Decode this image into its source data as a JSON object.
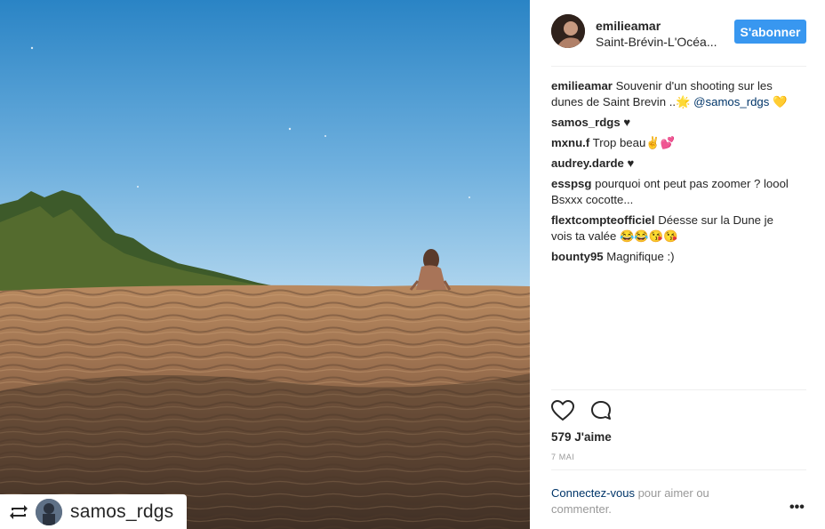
{
  "post": {
    "username": "emilieamar",
    "location": "Saint-Brévin-L'Océa...",
    "follow_label": "S'abonner",
    "caption": {
      "user": "emilieamar",
      "text": "Souvenir d'un shooting sur les dunes de Saint Brevin ..",
      "emoji": "🌟",
      "mention": "@samos_rdgs",
      "heart": "💛"
    },
    "comments": [
      {
        "user": "samos_rdgs",
        "text": "♥"
      },
      {
        "user": "mxnu.f",
        "text": "Trop beau✌💕"
      },
      {
        "user": "audrey.darde",
        "text": "♥"
      },
      {
        "user": "esspsg",
        "text": "pourquoi ont peut pas zoomer ? loool Bsxxx cocotte..."
      },
      {
        "user": "flextcompteofficiel",
        "text": "Déesse sur la Dune je vois ta valée 😂😂😘😘"
      },
      {
        "user": "bounty95",
        "text": "Magnifique :)"
      }
    ],
    "likes": "579 J'aime",
    "date": "7 MAI",
    "login_link": "Connectez-vous",
    "login_text": " pour aimer ou commenter.",
    "more": "•••",
    "icons": {
      "like": "heart-outline-icon",
      "comment": "speech-bubble-icon",
      "repost": "repost-icon"
    }
  },
  "photo": {
    "repost_user": "samos_rdgs"
  },
  "colors": {
    "follow_button": "#3897f0",
    "link": "#003569",
    "sky_top": "#2d86c7",
    "sky_bottom": "#a9d2ec",
    "sand": "#9b7152"
  }
}
